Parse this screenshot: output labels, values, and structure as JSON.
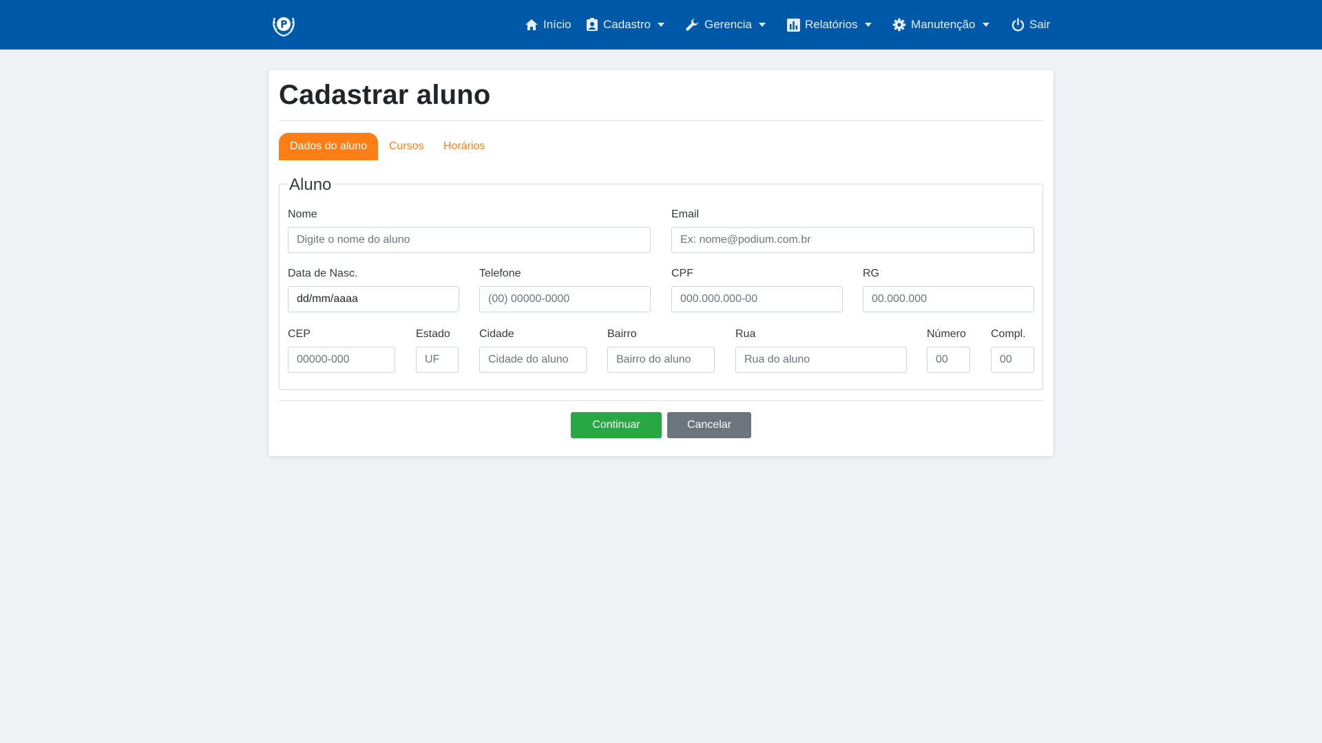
{
  "colors": {
    "navbar": "#0059a8",
    "background": "#eef2f5",
    "accent": "#fd7e14",
    "continue_button": "#28a745",
    "cancel_button": "#6c757d"
  },
  "nav": {
    "items": [
      {
        "label": "Início",
        "icon": "home-icon"
      },
      {
        "label": "Cadastro",
        "icon": "contact-card-icon",
        "dropdown": true
      },
      {
        "label": "Gerencia",
        "icon": "wrench-icon",
        "dropdown": true
      },
      {
        "label": "Relatórios",
        "icon": "bar-chart-icon",
        "dropdown": true
      },
      {
        "label": "Manutenção",
        "icon": "gear-icon",
        "dropdown": true
      },
      {
        "label": "Sair",
        "icon": "power-icon"
      }
    ]
  },
  "page": {
    "title": "Cadastrar aluno",
    "tabs": [
      {
        "label": "Dados do aluno",
        "active": true
      },
      {
        "label": "Cursos",
        "active": false
      },
      {
        "label": "Horários",
        "active": false
      }
    ]
  },
  "form": {
    "legend": "Aluno",
    "nome": {
      "label": "Nome",
      "placeholder": "Digite o nome do aluno"
    },
    "email": {
      "label": "Email",
      "placeholder": "Ex: nome@podium.com.br"
    },
    "data_nasc": {
      "label": "Data de Nasc.",
      "value": "dd/mm/aaaa"
    },
    "telefone": {
      "label": "Telefone",
      "placeholder": "(00) 00000-0000"
    },
    "cpf": {
      "label": "CPF",
      "placeholder": "000.000.000-00"
    },
    "rg": {
      "label": "RG",
      "placeholder": "00.000.000"
    },
    "cep": {
      "label": "CEP",
      "placeholder": "00000-000"
    },
    "estado": {
      "label": "Estado",
      "placeholder": "UF"
    },
    "cidade": {
      "label": "Cidade",
      "placeholder": "Cidade do aluno"
    },
    "bairro": {
      "label": "Bairro",
      "placeholder": "Bairro do aluno"
    },
    "rua": {
      "label": "Rua",
      "placeholder": "Rua do aluno"
    },
    "numero": {
      "label": "Número",
      "placeholder": "00"
    },
    "compl": {
      "label": "Compl.",
      "placeholder": "00"
    }
  },
  "actions": {
    "continue_label": "Continuar",
    "cancel_label": "Cancelar"
  }
}
